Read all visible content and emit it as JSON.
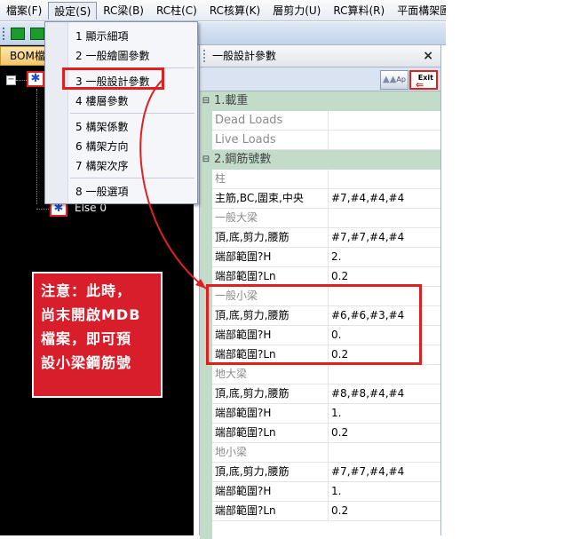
{
  "menubar": {
    "items": [
      "檔案(F)",
      "設定(S)",
      "RC梁(B)",
      "RC柱(C)",
      "RC核算(K)",
      "層剪力(U)",
      "RC算料(R)",
      "平面構架圖(I)"
    ]
  },
  "left_panel": {
    "tab_label": "BOM檔",
    "tree_collapse_symbol": "−",
    "tree_item_label": "Else 0"
  },
  "dropdown": {
    "items": [
      "1 顯示細項",
      "2 一般繪圖參數",
      "3 一般設計參數",
      "4 樓層參數",
      "5 構架係數",
      "6 構架方向",
      "7 構架次序",
      "8 一般選項"
    ]
  },
  "property_panel": {
    "title": "一般設計參數",
    "close_symbol": "×",
    "apply_label": "Ap",
    "exit_label": "Exit",
    "categories": {
      "loads": "1.載重",
      "rebar": "2.鋼筋號數"
    },
    "rows": {
      "dead_loads": {
        "name": "Dead Loads",
        "value": ""
      },
      "live_loads": {
        "name": "Live Loads",
        "value": ""
      },
      "column_group": "柱",
      "column_main": {
        "name": "主筋,BC,圍束,中央",
        "value": "#7,#4,#4,#4"
      },
      "girder_group": "一般大梁",
      "girder_rebar": {
        "name": "頂,底,剪力,腰筋",
        "value": "#7,#7,#4,#4"
      },
      "girder_end_h": {
        "name": "端部範圍?H",
        "value": "2."
      },
      "girder_end_ln": {
        "name": "端部範圍?Ln",
        "value": "0.2"
      },
      "beam_group": "一般小梁",
      "beam_rebar": {
        "name": "頂,底,剪力,腰筋",
        "value": "#6,#6,#3,#4"
      },
      "beam_end_h": {
        "name": "端部範圍?H",
        "value": "0."
      },
      "beam_end_ln": {
        "name": "端部範圍?Ln",
        "value": "0.2"
      },
      "ground_girder_group": "地大梁",
      "ground_girder_rebar": {
        "name": "頂,底,剪力,腰筋",
        "value": "#8,#8,#4,#4"
      },
      "ground_girder_end_h": {
        "name": "端部範圍?H",
        "value": "1."
      },
      "ground_girder_end_ln": {
        "name": "端部範圍?Ln",
        "value": "0.2"
      },
      "ground_beam_group": "地小梁",
      "ground_beam_rebar": {
        "name": "頂,底,剪力,腰筋",
        "value": "#7,#7,#4,#4"
      },
      "ground_beam_end_h": {
        "name": "端部範圍?H",
        "value": "1."
      },
      "ground_beam_end_ln": {
        "name": "端部範圍?Ln",
        "value": "0.2"
      }
    },
    "collapse_symbol": "⊟"
  },
  "annotation": {
    "lines": [
      "注意：此時，",
      "尚末開啟MDB",
      "檔案，即可預",
      "設小梁鋼筋號"
    ],
    "color": "#d91e2b"
  }
}
